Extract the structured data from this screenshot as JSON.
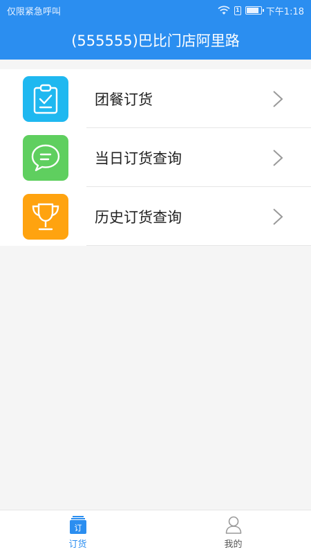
{
  "status_bar": {
    "carrier": "仅限紧急呼叫",
    "sim_label": "1",
    "time": "下午1:18",
    "battery_level": 0.85
  },
  "header": {
    "title": "(555555)巴比门店阿里路"
  },
  "menu": {
    "items": [
      {
        "label": "团餐订货",
        "icon": "clipboard-check-icon",
        "color": "#1fb8f0"
      },
      {
        "label": "当日订货查询",
        "icon": "chat-bubble-icon",
        "color": "#5fcf5f"
      },
      {
        "label": "历史订货查询",
        "icon": "trophy-icon",
        "color": "#ffa30f"
      }
    ]
  },
  "tabs": [
    {
      "label": "订货",
      "icon": "order-doc-icon",
      "icon_text": "订",
      "active": true
    },
    {
      "label": "我的",
      "icon": "user-icon",
      "active": false
    }
  ],
  "colors": {
    "primary": "#2b8ef0",
    "background": "#f5f5f5"
  }
}
